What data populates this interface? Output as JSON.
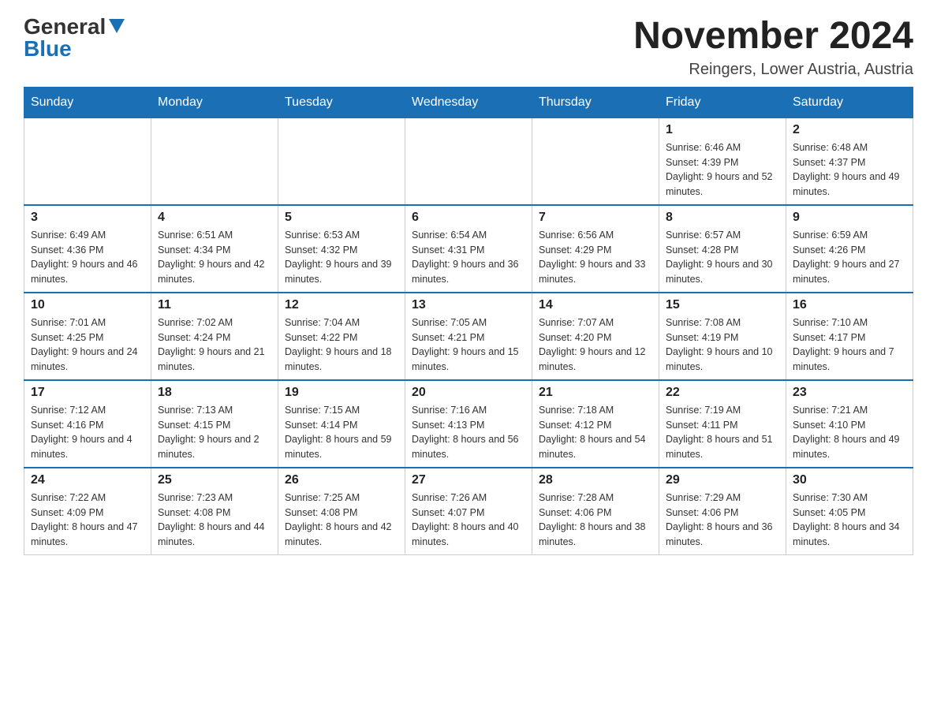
{
  "header": {
    "logo_general": "General",
    "logo_blue": "Blue",
    "month_title": "November 2024",
    "location": "Reingers, Lower Austria, Austria"
  },
  "weekdays": [
    "Sunday",
    "Monday",
    "Tuesday",
    "Wednesday",
    "Thursday",
    "Friday",
    "Saturday"
  ],
  "weeks": [
    [
      {
        "day": "",
        "sunrise": "",
        "sunset": "",
        "daylight": ""
      },
      {
        "day": "",
        "sunrise": "",
        "sunset": "",
        "daylight": ""
      },
      {
        "day": "",
        "sunrise": "",
        "sunset": "",
        "daylight": ""
      },
      {
        "day": "",
        "sunrise": "",
        "sunset": "",
        "daylight": ""
      },
      {
        "day": "",
        "sunrise": "",
        "sunset": "",
        "daylight": ""
      },
      {
        "day": "1",
        "sunrise": "Sunrise: 6:46 AM",
        "sunset": "Sunset: 4:39 PM",
        "daylight": "Daylight: 9 hours and 52 minutes."
      },
      {
        "day": "2",
        "sunrise": "Sunrise: 6:48 AM",
        "sunset": "Sunset: 4:37 PM",
        "daylight": "Daylight: 9 hours and 49 minutes."
      }
    ],
    [
      {
        "day": "3",
        "sunrise": "Sunrise: 6:49 AM",
        "sunset": "Sunset: 4:36 PM",
        "daylight": "Daylight: 9 hours and 46 minutes."
      },
      {
        "day": "4",
        "sunrise": "Sunrise: 6:51 AM",
        "sunset": "Sunset: 4:34 PM",
        "daylight": "Daylight: 9 hours and 42 minutes."
      },
      {
        "day": "5",
        "sunrise": "Sunrise: 6:53 AM",
        "sunset": "Sunset: 4:32 PM",
        "daylight": "Daylight: 9 hours and 39 minutes."
      },
      {
        "day": "6",
        "sunrise": "Sunrise: 6:54 AM",
        "sunset": "Sunset: 4:31 PM",
        "daylight": "Daylight: 9 hours and 36 minutes."
      },
      {
        "day": "7",
        "sunrise": "Sunrise: 6:56 AM",
        "sunset": "Sunset: 4:29 PM",
        "daylight": "Daylight: 9 hours and 33 minutes."
      },
      {
        "day": "8",
        "sunrise": "Sunrise: 6:57 AM",
        "sunset": "Sunset: 4:28 PM",
        "daylight": "Daylight: 9 hours and 30 minutes."
      },
      {
        "day": "9",
        "sunrise": "Sunrise: 6:59 AM",
        "sunset": "Sunset: 4:26 PM",
        "daylight": "Daylight: 9 hours and 27 minutes."
      }
    ],
    [
      {
        "day": "10",
        "sunrise": "Sunrise: 7:01 AM",
        "sunset": "Sunset: 4:25 PM",
        "daylight": "Daylight: 9 hours and 24 minutes."
      },
      {
        "day": "11",
        "sunrise": "Sunrise: 7:02 AM",
        "sunset": "Sunset: 4:24 PM",
        "daylight": "Daylight: 9 hours and 21 minutes."
      },
      {
        "day": "12",
        "sunrise": "Sunrise: 7:04 AM",
        "sunset": "Sunset: 4:22 PM",
        "daylight": "Daylight: 9 hours and 18 minutes."
      },
      {
        "day": "13",
        "sunrise": "Sunrise: 7:05 AM",
        "sunset": "Sunset: 4:21 PM",
        "daylight": "Daylight: 9 hours and 15 minutes."
      },
      {
        "day": "14",
        "sunrise": "Sunrise: 7:07 AM",
        "sunset": "Sunset: 4:20 PM",
        "daylight": "Daylight: 9 hours and 12 minutes."
      },
      {
        "day": "15",
        "sunrise": "Sunrise: 7:08 AM",
        "sunset": "Sunset: 4:19 PM",
        "daylight": "Daylight: 9 hours and 10 minutes."
      },
      {
        "day": "16",
        "sunrise": "Sunrise: 7:10 AM",
        "sunset": "Sunset: 4:17 PM",
        "daylight": "Daylight: 9 hours and 7 minutes."
      }
    ],
    [
      {
        "day": "17",
        "sunrise": "Sunrise: 7:12 AM",
        "sunset": "Sunset: 4:16 PM",
        "daylight": "Daylight: 9 hours and 4 minutes."
      },
      {
        "day": "18",
        "sunrise": "Sunrise: 7:13 AM",
        "sunset": "Sunset: 4:15 PM",
        "daylight": "Daylight: 9 hours and 2 minutes."
      },
      {
        "day": "19",
        "sunrise": "Sunrise: 7:15 AM",
        "sunset": "Sunset: 4:14 PM",
        "daylight": "Daylight: 8 hours and 59 minutes."
      },
      {
        "day": "20",
        "sunrise": "Sunrise: 7:16 AM",
        "sunset": "Sunset: 4:13 PM",
        "daylight": "Daylight: 8 hours and 56 minutes."
      },
      {
        "day": "21",
        "sunrise": "Sunrise: 7:18 AM",
        "sunset": "Sunset: 4:12 PM",
        "daylight": "Daylight: 8 hours and 54 minutes."
      },
      {
        "day": "22",
        "sunrise": "Sunrise: 7:19 AM",
        "sunset": "Sunset: 4:11 PM",
        "daylight": "Daylight: 8 hours and 51 minutes."
      },
      {
        "day": "23",
        "sunrise": "Sunrise: 7:21 AM",
        "sunset": "Sunset: 4:10 PM",
        "daylight": "Daylight: 8 hours and 49 minutes."
      }
    ],
    [
      {
        "day": "24",
        "sunrise": "Sunrise: 7:22 AM",
        "sunset": "Sunset: 4:09 PM",
        "daylight": "Daylight: 8 hours and 47 minutes."
      },
      {
        "day": "25",
        "sunrise": "Sunrise: 7:23 AM",
        "sunset": "Sunset: 4:08 PM",
        "daylight": "Daylight: 8 hours and 44 minutes."
      },
      {
        "day": "26",
        "sunrise": "Sunrise: 7:25 AM",
        "sunset": "Sunset: 4:08 PM",
        "daylight": "Daylight: 8 hours and 42 minutes."
      },
      {
        "day": "27",
        "sunrise": "Sunrise: 7:26 AM",
        "sunset": "Sunset: 4:07 PM",
        "daylight": "Daylight: 8 hours and 40 minutes."
      },
      {
        "day": "28",
        "sunrise": "Sunrise: 7:28 AM",
        "sunset": "Sunset: 4:06 PM",
        "daylight": "Daylight: 8 hours and 38 minutes."
      },
      {
        "day": "29",
        "sunrise": "Sunrise: 7:29 AM",
        "sunset": "Sunset: 4:06 PM",
        "daylight": "Daylight: 8 hours and 36 minutes."
      },
      {
        "day": "30",
        "sunrise": "Sunrise: 7:30 AM",
        "sunset": "Sunset: 4:05 PM",
        "daylight": "Daylight: 8 hours and 34 minutes."
      }
    ]
  ]
}
